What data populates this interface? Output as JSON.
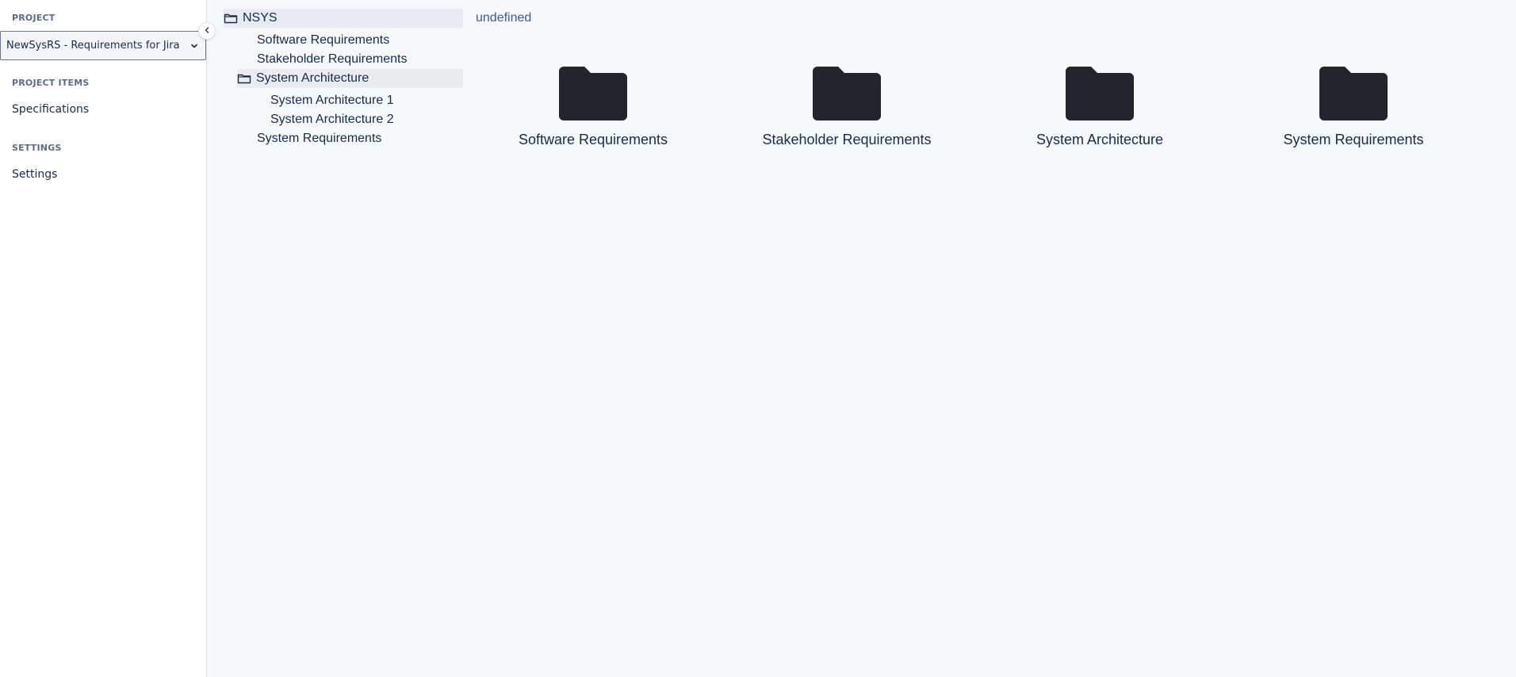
{
  "sidebar": {
    "project_label": "PROJECT",
    "project_select": "NewSysRS - Requirements for Jira",
    "project_items_label": "PROJECT ITEMS",
    "specifications": "Specifications",
    "settings_label": "SETTINGS",
    "settings": "Settings"
  },
  "tree": {
    "root": "NSYS",
    "items": [
      "Software Requirements",
      "Stakeholder Requirements",
      "System Architecture",
      "System Architecture 1",
      "System Architecture 2",
      "System Requirements"
    ]
  },
  "breadcrumb": "undefined",
  "folders": [
    "Software Requirements",
    "Stakeholder Requirements",
    "System Architecture",
    "System Requirements"
  ],
  "icons": {
    "folder_tile": "folder-icon",
    "tree_folder": "folder-outline-icon",
    "collapse": "chevron-left-icon",
    "dropdown": "chevron-down-icon"
  },
  "colors": {
    "page_bg": "#f7f8fa",
    "folder_fill": "#22252b",
    "link": "#3a5aa8"
  }
}
